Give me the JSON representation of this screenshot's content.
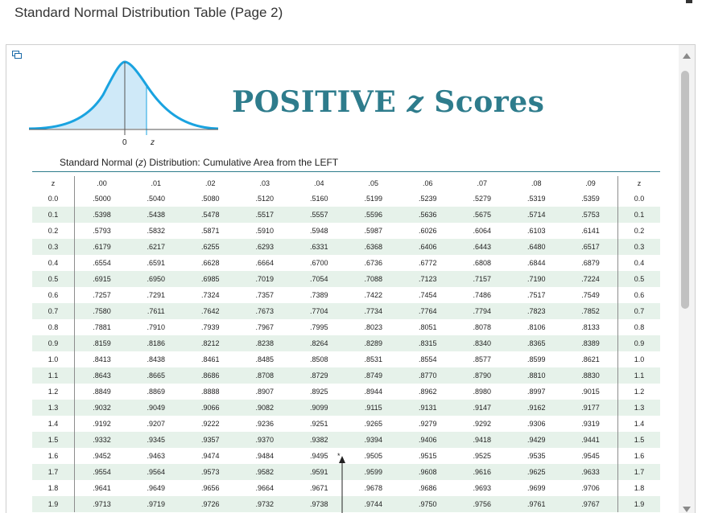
{
  "window": {
    "title": "Standard Normal Distribution Table (Page 2)"
  },
  "figure": {
    "heading_main": "POSITIVE ",
    "heading_z": "z",
    "heading_end": " Scores",
    "curve_label_zero": "0",
    "curve_label_z": "z",
    "subtitle_pre": "Standard Normal (",
    "subtitle_z": "z",
    "subtitle_post": ") Distribution: Cumulative Area from the LEFT",
    "asterisk": "*"
  },
  "table": {
    "z_header": "z",
    "columns": [
      ".00",
      ".01",
      ".02",
      ".03",
      ".04",
      ".05",
      ".06",
      ".07",
      ".08",
      ".09"
    ],
    "rows": [
      {
        "z": "0.0",
        "values": [
          ".5000",
          ".5040",
          ".5080",
          ".5120",
          ".5160",
          ".5199",
          ".5239",
          ".5279",
          ".5319",
          ".5359"
        ]
      },
      {
        "z": "0.1",
        "values": [
          ".5398",
          ".5438",
          ".5478",
          ".5517",
          ".5557",
          ".5596",
          ".5636",
          ".5675",
          ".5714",
          ".5753"
        ]
      },
      {
        "z": "0.2",
        "values": [
          ".5793",
          ".5832",
          ".5871",
          ".5910",
          ".5948",
          ".5987",
          ".6026",
          ".6064",
          ".6103",
          ".6141"
        ]
      },
      {
        "z": "0.3",
        "values": [
          ".6179",
          ".6217",
          ".6255",
          ".6293",
          ".6331",
          ".6368",
          ".6406",
          ".6443",
          ".6480",
          ".6517"
        ]
      },
      {
        "z": "0.4",
        "values": [
          ".6554",
          ".6591",
          ".6628",
          ".6664",
          ".6700",
          ".6736",
          ".6772",
          ".6808",
          ".6844",
          ".6879"
        ]
      },
      {
        "z": "0.5",
        "values": [
          ".6915",
          ".6950",
          ".6985",
          ".7019",
          ".7054",
          ".7088",
          ".7123",
          ".7157",
          ".7190",
          ".7224"
        ]
      },
      {
        "z": "0.6",
        "values": [
          ".7257",
          ".7291",
          ".7324",
          ".7357",
          ".7389",
          ".7422",
          ".7454",
          ".7486",
          ".7517",
          ".7549"
        ]
      },
      {
        "z": "0.7",
        "values": [
          ".7580",
          ".7611",
          ".7642",
          ".7673",
          ".7704",
          ".7734",
          ".7764",
          ".7794",
          ".7823",
          ".7852"
        ]
      },
      {
        "z": "0.8",
        "values": [
          ".7881",
          ".7910",
          ".7939",
          ".7967",
          ".7995",
          ".8023",
          ".8051",
          ".8078",
          ".8106",
          ".8133"
        ]
      },
      {
        "z": "0.9",
        "values": [
          ".8159",
          ".8186",
          ".8212",
          ".8238",
          ".8264",
          ".8289",
          ".8315",
          ".8340",
          ".8365",
          ".8389"
        ]
      },
      {
        "z": "1.0",
        "values": [
          ".8413",
          ".8438",
          ".8461",
          ".8485",
          ".8508",
          ".8531",
          ".8554",
          ".8577",
          ".8599",
          ".8621"
        ]
      },
      {
        "z": "1.1",
        "values": [
          ".8643",
          ".8665",
          ".8686",
          ".8708",
          ".8729",
          ".8749",
          ".8770",
          ".8790",
          ".8810",
          ".8830"
        ]
      },
      {
        "z": "1.2",
        "values": [
          ".8849",
          ".8869",
          ".8888",
          ".8907",
          ".8925",
          ".8944",
          ".8962",
          ".8980",
          ".8997",
          ".9015"
        ]
      },
      {
        "z": "1.3",
        "values": [
          ".9032",
          ".9049",
          ".9066",
          ".9082",
          ".9099",
          ".9115",
          ".9131",
          ".9147",
          ".9162",
          ".9177"
        ]
      },
      {
        "z": "1.4",
        "values": [
          ".9192",
          ".9207",
          ".9222",
          ".9236",
          ".9251",
          ".9265",
          ".9279",
          ".9292",
          ".9306",
          ".9319"
        ]
      },
      {
        "z": "1.5",
        "values": [
          ".9332",
          ".9345",
          ".9357",
          ".9370",
          ".9382",
          ".9394",
          ".9406",
          ".9418",
          ".9429",
          ".9441"
        ]
      },
      {
        "z": "1.6",
        "values": [
          ".9452",
          ".9463",
          ".9474",
          ".9484",
          ".9495",
          ".9505",
          ".9515",
          ".9525",
          ".9535",
          ".9545"
        ]
      },
      {
        "z": "1.7",
        "values": [
          ".9554",
          ".9564",
          ".9573",
          ".9582",
          ".9591",
          ".9599",
          ".9608",
          ".9616",
          ".9625",
          ".9633"
        ]
      },
      {
        "z": "1.8",
        "values": [
          ".9641",
          ".9649",
          ".9656",
          ".9664",
          ".9671",
          ".9678",
          ".9686",
          ".9693",
          ".9699",
          ".9706"
        ]
      },
      {
        "z": "1.9",
        "values": [
          ".9713",
          ".9719",
          ".9726",
          ".9732",
          ".9738",
          ".9744",
          ".9750",
          ".9756",
          ".9761",
          ".9767"
        ]
      }
    ]
  },
  "colors": {
    "heading": "#2e7c8c",
    "curve": "#1aa3e0",
    "fill": "#cfe9f8",
    "stripe": "#e6f2ea"
  },
  "icons": {
    "popout": "popout-icon",
    "scroll_up": "scroll-up-arrow-icon",
    "scroll_down": "scroll-down-arrow-icon",
    "pointer": "up-arrow-icon"
  }
}
